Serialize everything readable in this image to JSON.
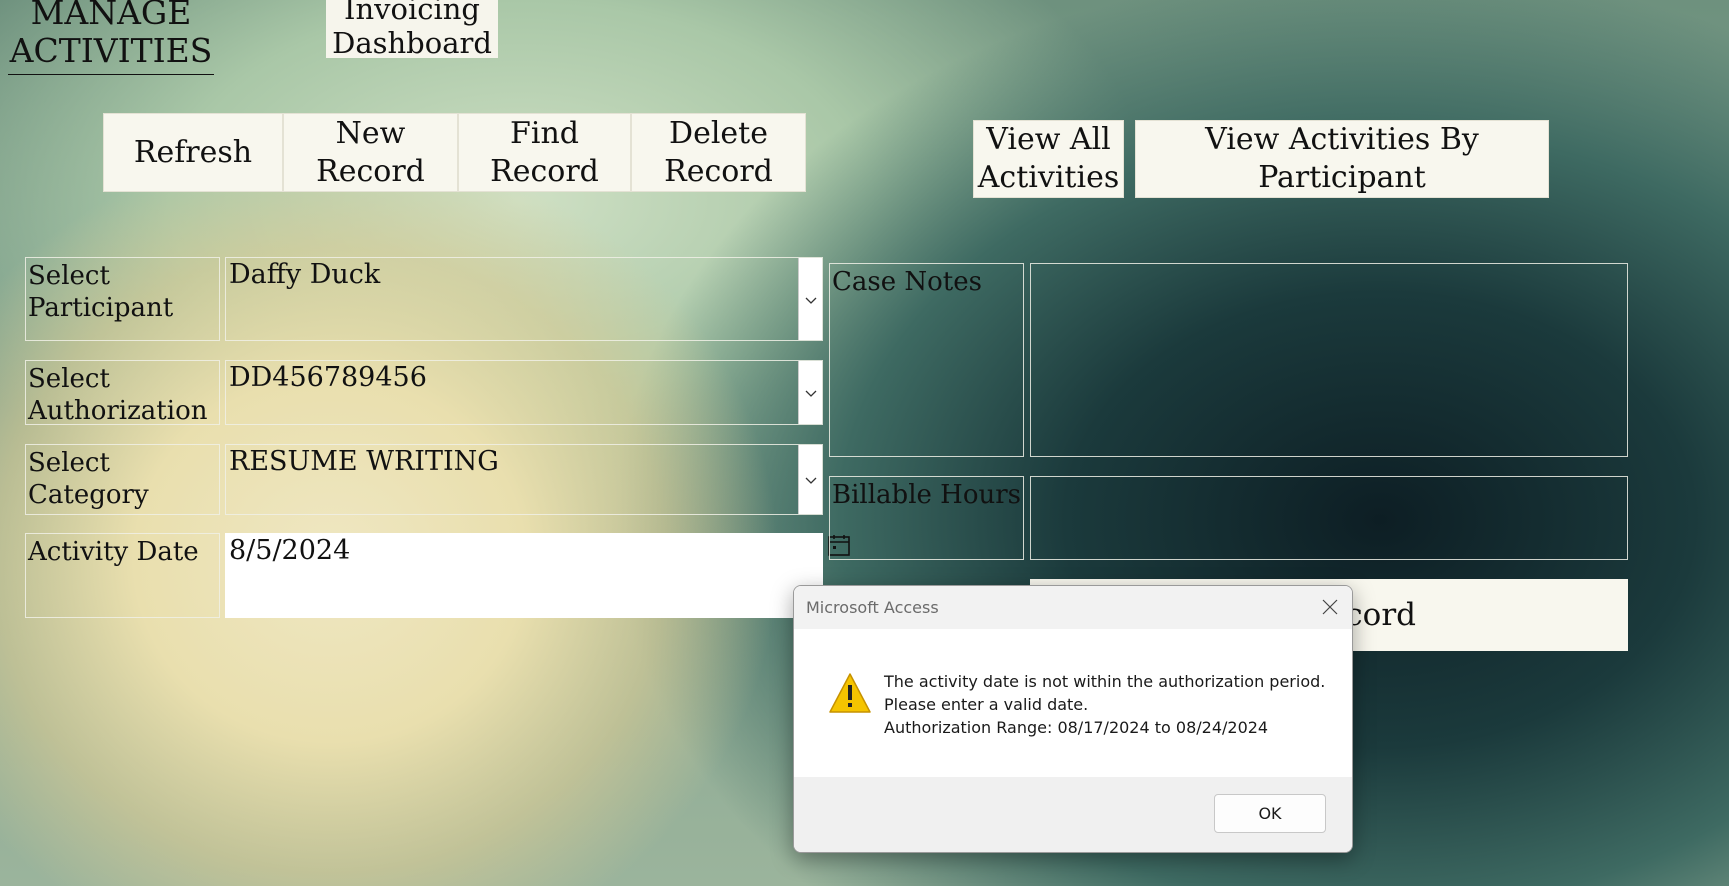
{
  "header": {
    "title": "MANAGE\nACTIVITIES",
    "invoicing_label": "Invoicing\nDashboard"
  },
  "toolbar": {
    "refresh": "Refresh",
    "new_record": "New\nRecord",
    "find_record": "Find\nRecord",
    "delete_record": "Delete\nRecord",
    "view_all": "View All\nActivities",
    "view_by_participant": "View Activities By\nParticipant"
  },
  "form": {
    "participant_label": "Select\nParticipant",
    "participant_value": "Daffy Duck",
    "authorization_label": "Select\nAuthorization",
    "authorization_value": "DD456789456",
    "category_label": "Select\nCategory",
    "category_value": "RESUME WRITING",
    "date_label": "Activity Date",
    "date_value": "8/5/2024",
    "case_notes_label": "Case Notes",
    "case_notes_value": "",
    "billable_hours_label": "Billable Hours",
    "billable_hours_value": "",
    "hidden_button_text": "cord"
  },
  "dialog": {
    "title": "Microsoft Access",
    "line1": "The activity date is not within the authorization period.",
    "line2": "Please enter a valid date.",
    "line3": "Authorization Range: 08/17/2024 to 08/24/2024",
    "ok_label": "OK"
  },
  "colors": {
    "button_bg": "#f8f7ee",
    "warning_yellow": "#f5c400",
    "dialog_bg": "#ffffff"
  }
}
